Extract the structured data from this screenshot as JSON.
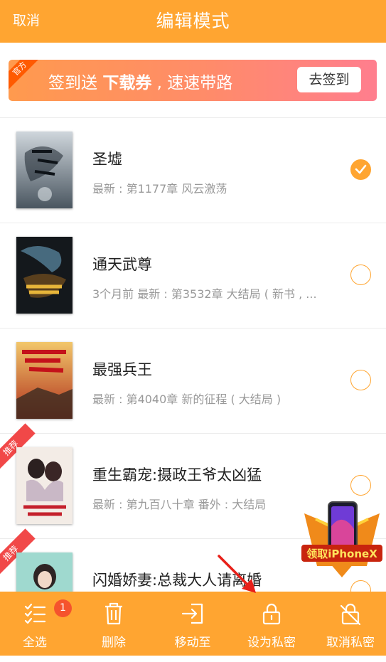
{
  "header": {
    "cancel_label": "取消",
    "title": "编辑模式"
  },
  "banner": {
    "ribbon": "官方",
    "text_prefix": "签到送 ",
    "text_bold": "下载券",
    "text_suffix": " , 速速带路",
    "button_label": "去签到"
  },
  "books": [
    {
      "title": "圣墟",
      "subtitle": "最新 : 第1177章 风云激荡",
      "checked": true,
      "tag": ""
    },
    {
      "title": "通天武尊",
      "subtitle": "3个月前 最新 : 第3532章 大结局 ( 新书 , ...",
      "checked": false,
      "tag": ""
    },
    {
      "title": "最强兵王",
      "subtitle": "最新 : 第4040章 新的征程 ( 大结局 )",
      "checked": false,
      "tag": ""
    },
    {
      "title": "重生霸宠:摄政王爷太凶猛",
      "subtitle": "最新 : 第九百八十章 番外 : 大结局",
      "checked": false,
      "tag": "推荐"
    },
    {
      "title": "闪婚娇妻:总裁大人请离婚",
      "subtitle": "",
      "checked": false,
      "tag": "推荐"
    }
  ],
  "promo": {
    "label": "领取iPhoneX"
  },
  "toolbar": {
    "select_all": "全选",
    "select_all_badge": "1",
    "delete": "删除",
    "move_to": "移动至",
    "set_private": "设为私密",
    "cancel_private": "取消私密"
  },
  "colors": {
    "accent": "#FFA531",
    "badge": "#F5532D",
    "tag": "#F14848"
  }
}
